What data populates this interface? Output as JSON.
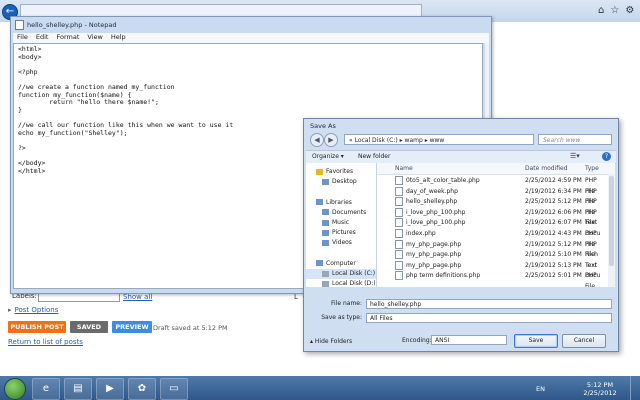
{
  "notepad": {
    "title": "hello_shelley.php - Notepad",
    "menu": [
      "File",
      "Edit",
      "Format",
      "View",
      "Help"
    ],
    "text": "<html>\n<body>\n\n<?php\n\n//we create a function named my_function\nfunction my_function($name) {\n        return \"hello there $name!\";\n}\n\n//we call our function like this when we want to use it\necho my_function(\"Shelley\");\n\n?>\n\n</body>\n</html>"
  },
  "blog": {
    "labels_label": "Labels:",
    "show_all": "Show all",
    "l_fragment": "L",
    "post_options": "Post Options",
    "publish": "PUBLISH POST",
    "saved": "SAVED",
    "preview": "PREVIEW",
    "draft_status": "Draft saved at 5:12 PM",
    "return_link": "Return to list of posts"
  },
  "saveas": {
    "title": "Save As",
    "path": "« Local Disk (C:) ▸ wamp ▸ www",
    "search_placeholder": "Search www",
    "organize": "Organize ▾",
    "new_folder": "New folder",
    "nav_items": [
      {
        "label": "Favorites",
        "icon": "star-icon"
      },
      {
        "label": "Desktop",
        "icon": "desktop-icon"
      },
      {
        "label": "",
        "icon": ""
      },
      {
        "label": "Libraries",
        "icon": "library-icon"
      },
      {
        "label": "Documents",
        "icon": "documents-icon"
      },
      {
        "label": "Music",
        "icon": "music-icon"
      },
      {
        "label": "Pictures",
        "icon": "pictures-icon"
      },
      {
        "label": "Videos",
        "icon": "videos-icon"
      },
      {
        "label": "",
        "icon": ""
      },
      {
        "label": "Computer",
        "icon": "computer-icon"
      },
      {
        "label": "Local Disk (C:)",
        "icon": "drive-icon"
      },
      {
        "label": "Local Disk (D:)",
        "icon": "drive-icon"
      }
    ],
    "columns": [
      "Name",
      "Date modified",
      "Type"
    ],
    "files": [
      {
        "name": "0to5_alt_color_table.php",
        "date": "2/25/2012 4:59 PM",
        "type": "PHP File"
      },
      {
        "name": "day_of_week.php",
        "date": "2/19/2012 6:34 PM",
        "type": "PHP File"
      },
      {
        "name": "hello_shelley.php",
        "date": "2/25/2012 5:12 PM",
        "type": "PHP File"
      },
      {
        "name": "i_love_php_100.php",
        "date": "2/19/2012 6:06 PM",
        "type": "PHP File"
      },
      {
        "name": "i_love_php_100.php",
        "date": "2/19/2012 6:07 PM",
        "type": "Text Docu"
      },
      {
        "name": "index.php",
        "date": "2/19/2012 4:43 PM",
        "type": "PHP File"
      },
      {
        "name": "my_php_page.php",
        "date": "2/19/2012 5:12 PM",
        "type": "PHP File"
      },
      {
        "name": "my_php_page.php",
        "date": "2/19/2012 5:10 PM",
        "type": "Rich Text"
      },
      {
        "name": "my_php_page.php",
        "date": "2/19/2012 5:13 PM",
        "type": "Text Docu"
      },
      {
        "name": "php term definitions.php",
        "date": "2/25/2012 5:01 PM",
        "type": "PHP File"
      }
    ],
    "file_name_label": "File name:",
    "file_name_value": "hello_shelley.php",
    "save_type_label": "Save as type:",
    "save_type_value": "All Files",
    "hide_folders": "Hide Folders",
    "encoding_label": "Encoding:",
    "encoding_value": "ANSI",
    "save": "Save",
    "cancel": "Cancel"
  },
  "taskbar": {
    "lang": "EN",
    "time": "5:12 PM",
    "date": "2/25/2012"
  }
}
